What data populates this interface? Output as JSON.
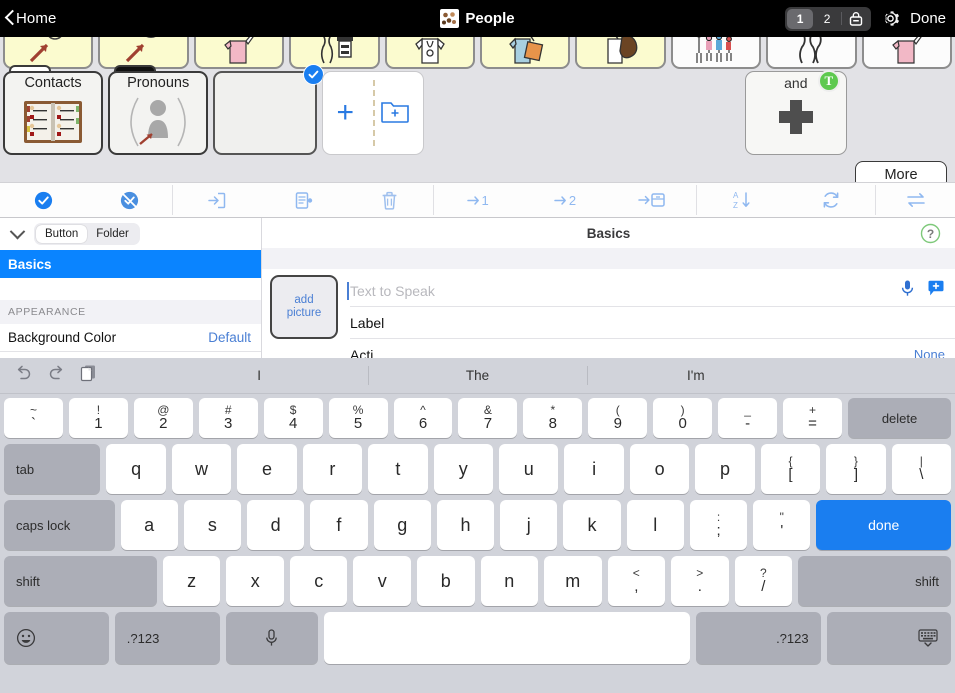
{
  "navbar": {
    "back_label": "Home",
    "title": "People",
    "title_icon": "people-photo-icon",
    "segmented": [
      "1",
      "2"
    ],
    "segmented_active": "1",
    "lock_icon": "lock-icon",
    "gear_icon": "gear-icon",
    "done_label": "Done"
  },
  "grid": {
    "top_row": [
      {
        "name": "arrow-symbol-1",
        "kind": "yellow"
      },
      {
        "name": "arrow-symbol-2",
        "kind": "yellow"
      },
      {
        "name": "pink-shirt-person",
        "kind": "yellow"
      },
      {
        "name": "person-at-desk",
        "kind": "yellow"
      },
      {
        "name": "doctor-stethoscope",
        "kind": "yellow"
      },
      {
        "name": "person-with-clipboard",
        "kind": "yellow"
      },
      {
        "name": "person-dark-hair",
        "kind": "yellow"
      },
      {
        "name": "family-group",
        "kind": "white"
      },
      {
        "name": "legs-walking",
        "kind": "white"
      },
      {
        "name": "pink-shirt-person-2",
        "kind": "white"
      }
    ],
    "folders": [
      {
        "label": "Contacts",
        "art": "address-book-icon",
        "tab": "light"
      },
      {
        "label": "Pronouns",
        "art": "person-pronoun-icon",
        "tab": "dark"
      }
    ],
    "selected_cell": {
      "name": "empty-selected-cell",
      "badge": "checkmark-badge"
    },
    "add_cell": {
      "plus": "+",
      "folder_plus": "add-folder-icon"
    },
    "and_cell": {
      "label": "and",
      "badge": "T",
      "art": "cross-plus-icon"
    },
    "more_label": "More"
  },
  "edit_toolbar": {
    "buttons": [
      {
        "name": "select-all-button",
        "icon": "check-circle-filled-icon"
      },
      {
        "name": "deselect-all-button",
        "icon": "check-circle-slash-icon"
      },
      {
        "name": "import-button",
        "icon": "arrow-into-box-icon"
      },
      {
        "name": "copy-to-button",
        "icon": "clipboard-arrow-icon"
      },
      {
        "name": "delete-button",
        "icon": "trash-icon"
      },
      {
        "name": "move-to-page-1-button",
        "icon": "arrow-1-icon",
        "label": "1"
      },
      {
        "name": "move-to-page-2-button",
        "icon": "arrow-2-icon",
        "label": "2"
      },
      {
        "name": "move-to-storage-button",
        "icon": "arrow-box-icon"
      },
      {
        "name": "sort-button",
        "icon": "sort-az-icon"
      },
      {
        "name": "refresh-button",
        "icon": "refresh-icon"
      },
      {
        "name": "swap-button",
        "icon": "swap-arrows-icon"
      }
    ]
  },
  "settings": {
    "collapse_icon": "chevron-down-icon",
    "type_toggle": [
      "Button",
      "Folder"
    ],
    "type_toggle_active": "Button",
    "selected_section": "Basics",
    "section_header": "APPEARANCE",
    "rows": [
      {
        "label": "Background Color",
        "value": "Default"
      }
    ],
    "right_title": "Basics",
    "help_icon": "help-circle-icon",
    "add_picture_line1": "add",
    "add_picture_line2": "picture",
    "text_to_speak_placeholder": "Text to Speak",
    "text_to_speak_value": "",
    "label_field": "Label",
    "action_field_partial": "Acti",
    "action_value_partial": "None",
    "mic_icon": "microphone-icon",
    "speech_icon": "speech-bubble-plus-icon"
  },
  "keyboard": {
    "undo_icon": "undo-arrow-icon",
    "redo_icon": "redo-arrow-icon",
    "paste_icon": "paste-clipboard-icon",
    "suggestions": [
      "I",
      "The",
      "I'm"
    ],
    "row_numbers": [
      {
        "up": "~",
        "lo": "`"
      },
      {
        "up": "!",
        "lo": "1"
      },
      {
        "up": "@",
        "lo": "2"
      },
      {
        "up": "#",
        "lo": "3"
      },
      {
        "up": "$",
        "lo": "4"
      },
      {
        "up": "%",
        "lo": "5"
      },
      {
        "up": "^",
        "lo": "6"
      },
      {
        "up": "&",
        "lo": "7"
      },
      {
        "up": "*",
        "lo": "8"
      },
      {
        "up": "(",
        "lo": "9"
      },
      {
        "up": ")",
        "lo": "0"
      },
      {
        "up": "_",
        "lo": "-"
      },
      {
        "up": "+",
        "lo": "="
      }
    ],
    "delete_label": "delete",
    "tab_label": "tab",
    "row_q": [
      "q",
      "w",
      "e",
      "r",
      "t",
      "y",
      "u",
      "i",
      "o",
      "p"
    ],
    "row_q_dual": [
      {
        "up": "{",
        "lo": "["
      },
      {
        "up": "}",
        "lo": "]"
      },
      {
        "up": "|",
        "lo": "\\"
      }
    ],
    "caps_label": "caps lock",
    "row_a": [
      "a",
      "s",
      "d",
      "f",
      "g",
      "h",
      "j",
      "k",
      "l"
    ],
    "row_a_dual": [
      {
        "up": ":",
        "lo": ";"
      },
      {
        "up": "\"",
        "lo": "'"
      }
    ],
    "done_label": "done",
    "shift_label": "shift",
    "row_z": [
      "z",
      "x",
      "c",
      "v",
      "b",
      "n",
      "m"
    ],
    "row_z_dual": [
      {
        "up": "<",
        "lo": ","
      },
      {
        "up": ">",
        "lo": "."
      },
      {
        "up": "?",
        "lo": "/"
      }
    ],
    "emoji_icon": "smiley-face-icon",
    "numeric_label": ".?123",
    "dictation_icon": "microphone-icon",
    "space_label": "",
    "hide_keyboard_icon": "hide-keyboard-icon"
  },
  "colors": {
    "accent_blue": "#0a84ff",
    "toolbar_blue": "#8fb8f0",
    "yellow_cell": "#fbfbcf",
    "key_mod": "#acaeb7",
    "keyboard_bg": "#d1d3da"
  }
}
